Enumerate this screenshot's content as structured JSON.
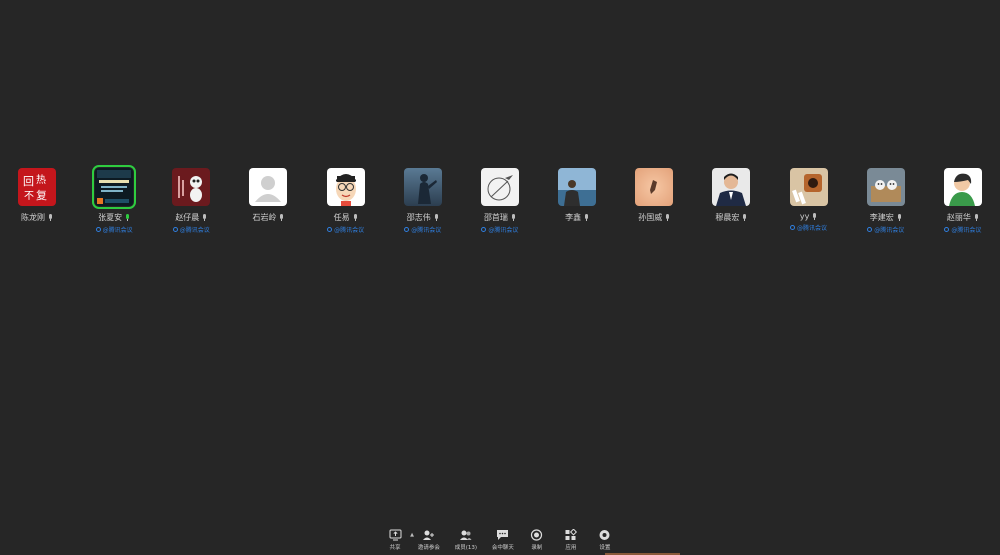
{
  "participants": [
    {
      "name": "陈龙刚",
      "tag": "",
      "speaking": false
    },
    {
      "name": "张夏安",
      "tag": "@腾讯会议",
      "speaking": true
    },
    {
      "name": "赵仔晨",
      "tag": "@腾讯会议",
      "speaking": false
    },
    {
      "name": "石岩岭",
      "tag": "",
      "speaking": false
    },
    {
      "name": "任易",
      "tag": "@腾讯会议",
      "speaking": false
    },
    {
      "name": "邵志伟",
      "tag": "@腾讯会议",
      "speaking": false
    },
    {
      "name": "邵首瑞",
      "tag": "@腾讯会议",
      "speaking": false
    },
    {
      "name": "李鑫",
      "tag": "",
      "speaking": false
    },
    {
      "name": "孙国威",
      "tag": "",
      "speaking": false
    },
    {
      "name": "穆晨宏",
      "tag": "",
      "speaking": false
    },
    {
      "name": "yy",
      "tag": "@腾讯会议",
      "speaking": false
    },
    {
      "name": "李建宏",
      "tag": "@腾讯会议",
      "speaking": false
    },
    {
      "name": "赵丽华",
      "tag": "@腾讯会议",
      "speaking": false
    }
  ],
  "toolbar": {
    "share": "共享",
    "invite": "邀请参会",
    "members": "成员(13)",
    "chat": "会中聊天",
    "record": "录制",
    "apps": "应用",
    "settings": "设置"
  },
  "colors": {
    "background": "#262626",
    "speaking_border": "#2ecc40",
    "tag": "#2f7fe0"
  }
}
